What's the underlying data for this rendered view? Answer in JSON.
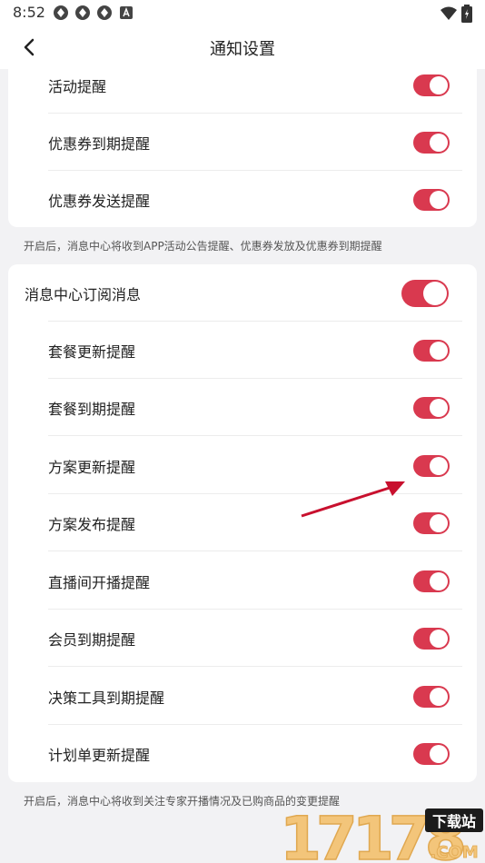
{
  "status_bar": {
    "time": "8:52",
    "icons": [
      "app-notification-icon",
      "app-notification-icon",
      "app-notification-icon",
      "a-icon"
    ],
    "right_icons": [
      "wifi-icon",
      "battery-icon"
    ]
  },
  "nav": {
    "title": "通知设置",
    "back_icon": "chevron-left-icon"
  },
  "section1": {
    "items": [
      {
        "label": "活动提醒",
        "on": true
      },
      {
        "label": "优惠券到期提醒",
        "on": true
      },
      {
        "label": "优惠券发送提醒",
        "on": true
      }
    ],
    "note": "开启后，消息中心将收到APP活动公告提醒、优惠券发放及优惠券到期提醒"
  },
  "section2": {
    "master": {
      "label": "消息中心订阅消息",
      "on": true
    },
    "items": [
      {
        "label": "套餐更新提醒",
        "on": true
      },
      {
        "label": "套餐到期提醒",
        "on": true
      },
      {
        "label": "方案更新提醒",
        "on": true
      },
      {
        "label": "方案发布提醒",
        "on": true
      },
      {
        "label": "直播间开播提醒",
        "on": true
      },
      {
        "label": "会员到期提醒",
        "on": true
      },
      {
        "label": "决策工具到期提醒",
        "on": true
      },
      {
        "label": "计划单更新提醒",
        "on": true
      }
    ],
    "note": "开启后，消息中心将收到关注专家开播情况及已购商品的变更提醒"
  },
  "colors": {
    "toggle_on": "#d9394f",
    "background": "#f2f2f4",
    "card": "#ffffff"
  },
  "watermark": {
    "text": "17178",
    "badge": "下载站",
    "suffix": ".COM"
  }
}
